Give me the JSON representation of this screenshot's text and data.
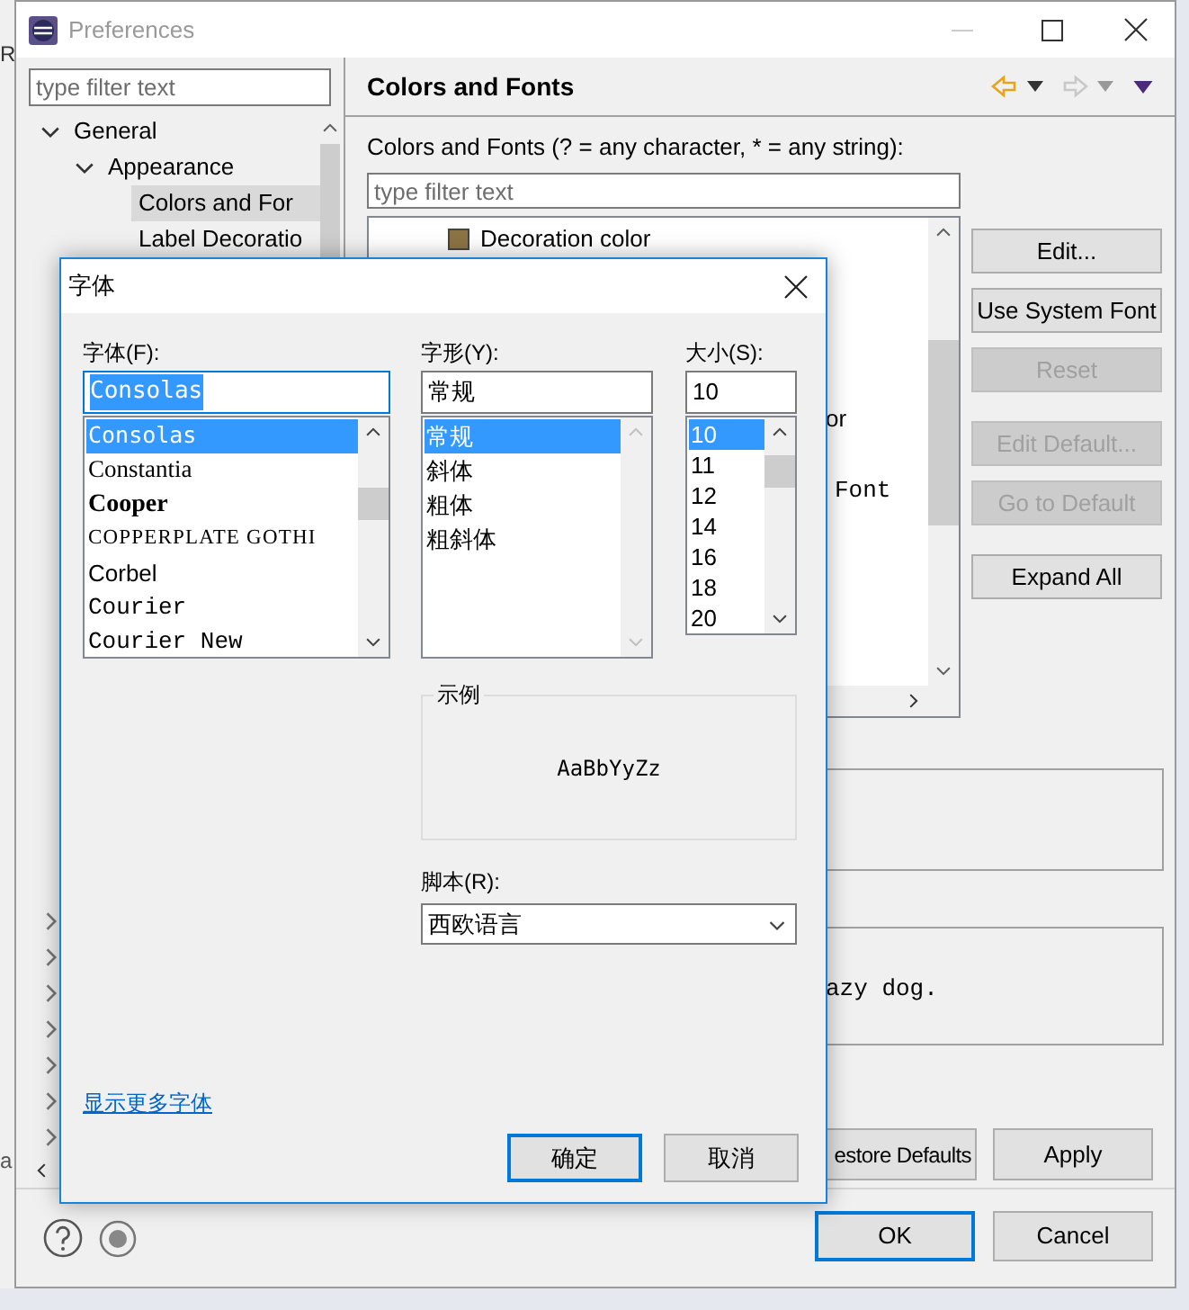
{
  "background_window": {
    "texts": [
      "R",
      "a"
    ]
  },
  "window": {
    "title": "Preferences"
  },
  "sidebar": {
    "filter_placeholder": "type filter text",
    "tree": [
      {
        "label": "General",
        "expanded": true,
        "selected": false,
        "children": [
          {
            "label": "Appearance",
            "expanded": true,
            "selected": false,
            "children": [
              {
                "label": "Colors and For",
                "selected": true
              },
              {
                "label": "Label Decoratio",
                "selected": false
              }
            ]
          }
        ]
      }
    ],
    "collapsed_rows": [
      {
        "expanded": false
      },
      {
        "expanded": false
      },
      {
        "expanded": false
      },
      {
        "expanded": false
      },
      {
        "expanded": false
      },
      {
        "expanded": false
      },
      {
        "expanded": false
      }
    ]
  },
  "page": {
    "title": "Colors and Fonts",
    "history": {
      "back": {
        "disabled": false
      },
      "forward": {
        "disabled": true
      }
    },
    "filter_label": "Colors and Fonts (? = any character, * = any string):",
    "filter_placeholder": "type filter text",
    "tree_items": [
      {
        "kind": "color",
        "label": "Decoration color",
        "color": "#8c7444"
      },
      {
        "kind": "text",
        "label": "or"
      },
      {
        "kind": "font",
        "label": "Font"
      }
    ],
    "button_groups": [
      [
        {
          "label": "Edit...",
          "disabled": false
        },
        {
          "label": "Use System Font",
          "disabled": false
        },
        {
          "label": "Reset",
          "disabled": true
        }
      ],
      [
        {
          "label": "Edit Default...",
          "disabled": true
        },
        {
          "label": "Go to Default",
          "disabled": true
        }
      ],
      [
        {
          "label": "Expand All",
          "disabled": false
        }
      ]
    ],
    "preview_text": "azy dog.",
    "footer_buttons": [
      "estore Defaults",
      "Apply"
    ]
  },
  "dialog_buttons": [
    {
      "label": "OK",
      "default": true
    },
    {
      "label": "Cancel",
      "default": false
    }
  ],
  "font_dialog": {
    "title": "字体",
    "font": {
      "label": "字体(F):",
      "value": "Consolas",
      "value_selected": true,
      "items": [
        {
          "label": "Consolas",
          "kind": "mono",
          "selected": true
        },
        {
          "label": "Constantia",
          "kind": "serif",
          "selected": false
        },
        {
          "label": "Cooper",
          "kind": "heavy",
          "selected": false
        },
        {
          "label": "COPPERPLATE GOTHI",
          "kind": "caps",
          "selected": false
        },
        {
          "label": "Corbel",
          "kind": "sans",
          "selected": false
        },
        {
          "label": "Courier",
          "kind": "courier",
          "selected": false
        },
        {
          "label": "Courier New",
          "kind": "courier",
          "selected": false
        }
      ]
    },
    "style": {
      "label": "字形(Y):",
      "value": "常规",
      "items": [
        {
          "label": "常规",
          "selected": true
        },
        {
          "label": "斜体",
          "selected": false
        },
        {
          "label": "粗体",
          "selected": false
        },
        {
          "label": "粗斜体",
          "selected": false
        }
      ]
    },
    "size": {
      "label": "大小(S):",
      "value": "10",
      "items": [
        {
          "label": "10",
          "selected": true
        },
        {
          "label": "11",
          "selected": false
        },
        {
          "label": "12",
          "selected": false
        },
        {
          "label": "14",
          "selected": false
        },
        {
          "label": "16",
          "selected": false
        },
        {
          "label": "18",
          "selected": false
        },
        {
          "label": "20",
          "selected": false
        }
      ]
    },
    "sample": {
      "label": "示例",
      "text": "AaBbYyZz"
    },
    "script": {
      "label": "脚本(R):",
      "value": "西欧语言"
    },
    "more_fonts_link": "显示更多字体",
    "buttons": [
      {
        "label": "确定",
        "default": true
      },
      {
        "label": "取消",
        "default": false
      }
    ]
  }
}
